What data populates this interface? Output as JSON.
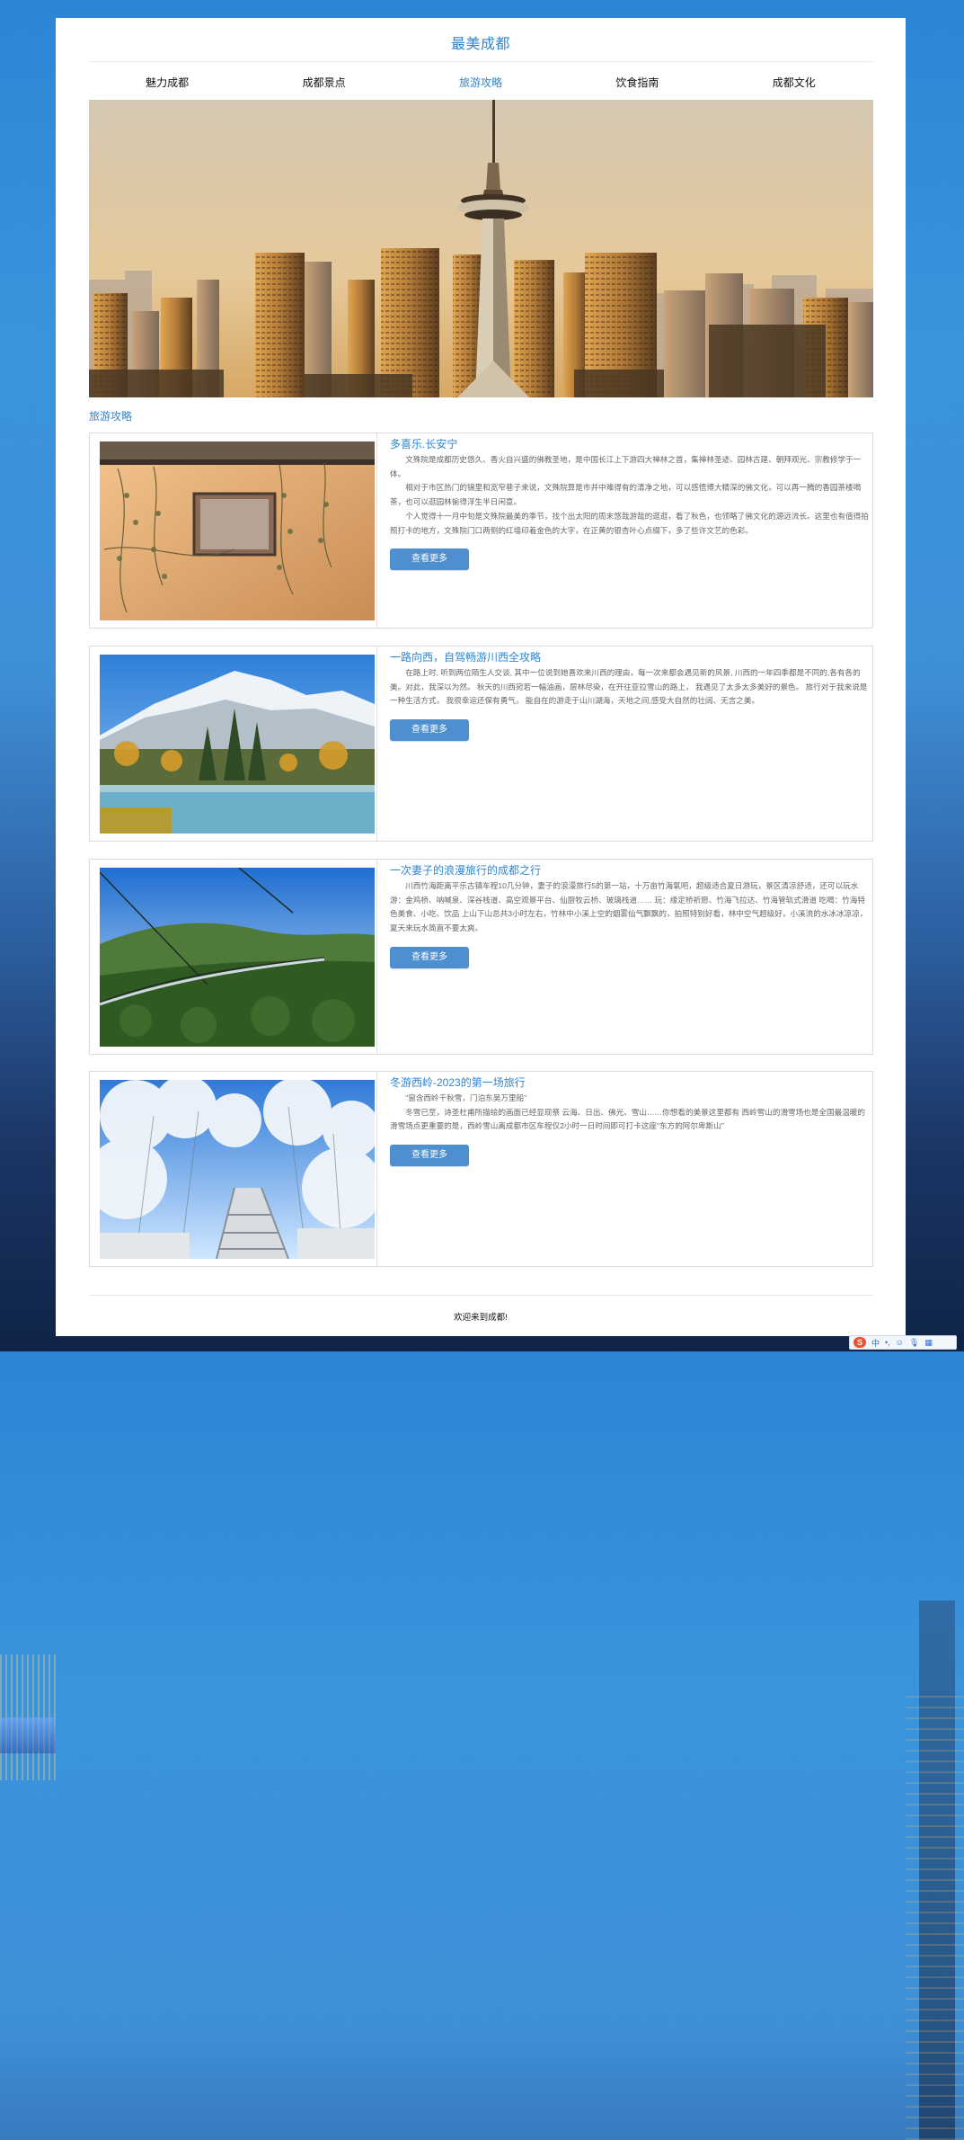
{
  "site": {
    "title": "最美成都"
  },
  "nav": {
    "items": [
      {
        "label": "魅力成都"
      },
      {
        "label": "成都景点"
      },
      {
        "label": "旅游攻略"
      },
      {
        "label": "饮食指南"
      },
      {
        "label": "成都文化"
      }
    ],
    "active_index": 2
  },
  "section": {
    "heading": "旅游攻略"
  },
  "cards": [
    {
      "title": "多喜乐.长安宁",
      "paragraphs": [
        "文殊院是成都历史悠久、香火自兴盛的佛教圣地，是中国长江上下游四大禅林之首，集禅林圣迹、园林古建、朝拜观光、宗教修学于一体。",
        "相对于市区热门的锦里和宽窄巷子来说，文殊院算是市井中难得有的清净之地，可以感悟博大精深的佛文化，可以再一腾的香园茶楼喝茶，也可以逛园林偷得浮生半日闲意。",
        "个人觉得十一月中旬是文殊院最美的季节，找个出太阳的周末悠哉游哉的逛逛，看了秋色，也领略了佛文化的源远流长。这里也有值得拍照打卡的地方，文殊院门口两侧的红墙印着金色的大字，在正黄的银杏叶心点缀下，多了些许文艺的色彩。"
      ],
      "button": "查看更多"
    },
    {
      "title": "一路向西，自驾畅游川西全攻略",
      "paragraphs": [
        "在路上时, 听到两位陌生人交谈, 其中一位说到她喜欢来川西的理由，每一次来都会遇见新的风景, 川西的一年四季都是不同的,各有各的美。对此，我深以为然。 秋天的川西宛若一幅油画，层林尽染，在开往亚拉雪山的路上， 我遇见了太多太多美好的景色。 旅行对于我来说是一种生活方式， 我很幸运还保有勇气， 能自在的游走于山川湖海，天地之间,感受大自然的壮阔、无言之美。"
      ],
      "button": "查看更多"
    },
    {
      "title": "一次妻子的浪漫旅行的成都之行",
      "paragraphs": [
        "川西竹海距离平乐古镇车程10几分钟，妻子的浪漫旅行5的第一站，十万亩竹海氧吧，超级适合夏日游玩，景区清凉舒适，还可以玩水 游：金鸡桥、呐喊泉、深谷栈道、高空观景平台、仙厨牧云桥、玻璃栈道…… 玩：缘定桥祈愿、竹海飞拉达、竹海管轨式滑道 吃喝：竹海特色美食、小吃、饮品 上山下山总共3小时左右，竹林中小溪上空的烟雾仙气飘飘的，拍照特别好看，林中空气超级好，小溪流的水冰冰凉凉，夏天来玩水简直不要太爽。"
      ],
      "button": "查看更多"
    },
    {
      "title": "冬游西岭-2023的第一场旅行",
      "paragraphs": [
        "\"窗含西岭千秋雪，门泊东吴万里船\"",
        "冬雪已至，诗圣杜甫所描绘的画面已经显现祭 云海、日出、佛光、雪山……你想看的美景这里都有 西岭雪山的滑雪场也是全国最温暖的滑雪场点更重要的是，西岭雪山离成都市区车程仅2小时一日时间即可打卡这座\"东方的阿尔卑斯山\""
      ],
      "button": "查看更多"
    }
  ],
  "footer": {
    "text": "欢迎来到成都!"
  },
  "ime": {
    "logo": "S",
    "items": [
      "中",
      "•,",
      "☺",
      "🎙",
      "▦"
    ]
  }
}
